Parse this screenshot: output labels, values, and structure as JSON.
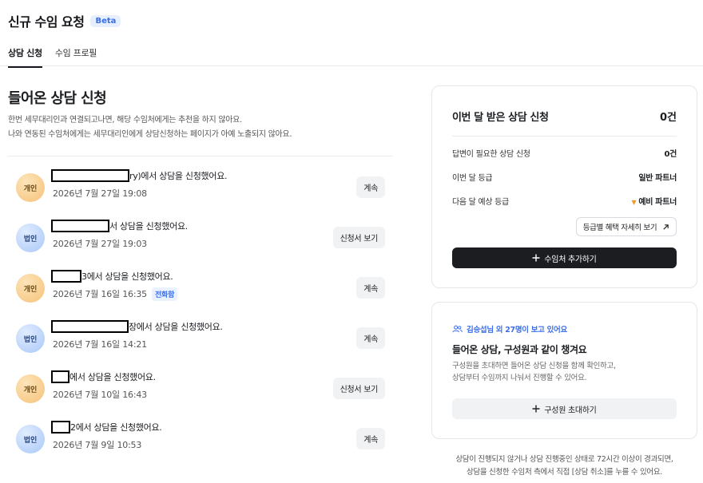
{
  "header": {
    "title": "신규 수임 요청",
    "badge": "Beta"
  },
  "tabs": [
    {
      "label": "상담 신청",
      "active": true
    },
    {
      "label": "수임 프로필",
      "active": false
    }
  ],
  "main": {
    "title": "들어온 상담 신청",
    "desc_line1": "한번 세무대리인과 연결되고나면, 해당 수임처에게는 추천을 하지 않아요.",
    "desc_line2": "나와 연동된 수임처에게는 세무대리인에게 상담신청하는 페이지가 아예 노출되지 않아요.",
    "requests": [
      {
        "type": "개인",
        "text": "ry)에서 상담을 신청했어요.",
        "date": "2026년 7월 27일 19:08",
        "tag": "",
        "action": "계속"
      },
      {
        "type": "법인",
        "text": "서 상담을 신청했어요.",
        "date": "2026년 7월 27일 19:03",
        "tag": "",
        "action": "신청서 보기"
      },
      {
        "type": "개인",
        "text": "3에서 상담을 신청했어요.",
        "date": "2026년 7월 16일 16:35",
        "tag": "전화함",
        "action": "계속"
      },
      {
        "type": "법인",
        "text": "장에서 상담을 신청했어요.",
        "date": "2026년 7월 16일 14:21",
        "tag": "",
        "action": "계속"
      },
      {
        "type": "개인",
        "text": "에서 상담을 신청했어요.",
        "date": "2026년 7월 10일 16:43",
        "tag": "",
        "action": "신청서 보기"
      },
      {
        "type": "법인",
        "text": "2에서 상담을 신청했어요.",
        "date": "2026년 7월 9일 10:53",
        "tag": "",
        "action": "계속"
      }
    ]
  },
  "stats": {
    "title": "이번 달 받은 상담 신청",
    "title_value": "0건",
    "rows": [
      {
        "label": "답변이 필요한 상담 신청",
        "value": "0건"
      },
      {
        "label": "이번 달 등급",
        "value": "일반 파트너"
      },
      {
        "label": "다음 달 예상 등급",
        "value": "예비 파트너"
      }
    ],
    "benefit_button": "등급별 혜택 자세히 보기",
    "primary_button": "수임처 추가하기"
  },
  "invite": {
    "subtitle": "김승섭님 외 27명이 보고 있어요",
    "title": "들어온 상담, 구성원과 같이 챙겨요",
    "desc_line1": "구성원을 초대하면 들어온 상담 신청을 함께 확인하고,",
    "desc_line2": "상담부터 수임까지 나눠서 진행할 수 있어요.",
    "button": "구성원 초대하기"
  },
  "footnote": {
    "line1": "상담이 진행되지 않거나 상담 진행중인 상태로 72시간 이상이 경과되면,",
    "line2": "상담을 신청한 수임처 측에서 직접 [상담 취소]를 누를 수 있어요."
  },
  "colors": {
    "accent": "#3a6ee8",
    "dark": "#1b1d21",
    "warning": "#f29a2e"
  }
}
